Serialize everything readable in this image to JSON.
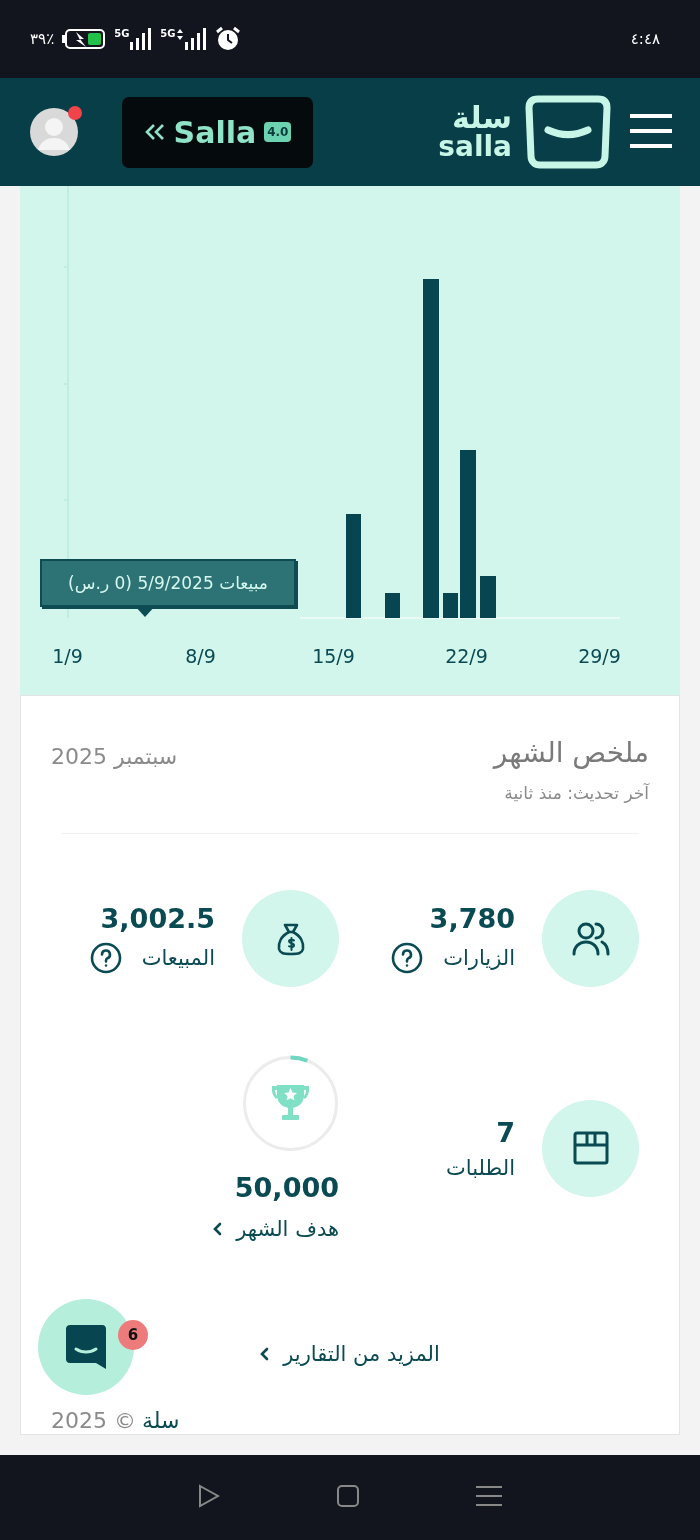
{
  "status_bar": {
    "time": "٤:٤٨",
    "battery": "٣٩٪",
    "signals": [
      {
        "label": "5G"
      },
      {
        "label": "5G"
      }
    ]
  },
  "header": {
    "logo": {
      "arabic": "سلة",
      "latin": "salla"
    },
    "version_button": {
      "label": "Salla",
      "badge": "4.0"
    },
    "avatar": {
      "notification_dot": true
    }
  },
  "chart": {
    "tooltip": "مبيعات 5/9/2025 (0 ر.س)",
    "x_labels": [
      "29/9",
      "22/9",
      "15/9",
      "8/9",
      "1/9"
    ]
  },
  "summary": {
    "title": "ملخص الشهر",
    "period": "سبتمبر 2025",
    "updated": "آخر تحديث: منذ ثانية",
    "stats": [
      {
        "kind": "visits",
        "value": "3,780",
        "label": "الزيارات",
        "help": true
      },
      {
        "kind": "sales",
        "value": "3,002.5",
        "label": "المبيعات",
        "help": true
      },
      {
        "kind": "orders",
        "value": "7",
        "label": "الطلبات",
        "help": false
      },
      {
        "kind": "goal",
        "value": "50,000",
        "label": "هدف الشهر",
        "level": 0.06
      }
    ],
    "more_link": "المزيد من التقارير"
  },
  "chat": {
    "badge": "6"
  },
  "footer": {
    "brand": "سلة",
    "copyright": "© 2025"
  }
}
